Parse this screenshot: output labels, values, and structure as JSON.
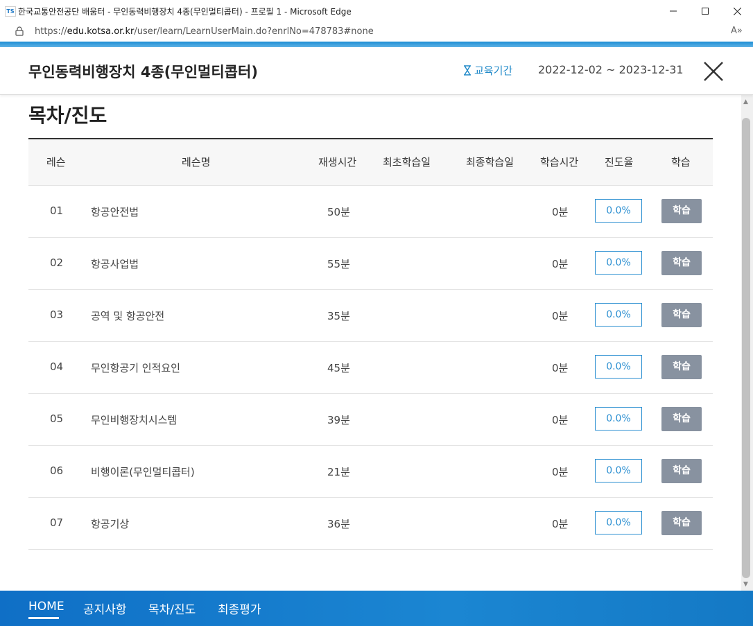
{
  "browser": {
    "logo_text": "TS",
    "window_title": "한국교통안전공단 배움터 - 무인동력비행장치 4종(무인멀티콥터) - 프로필 1 - Microsoft Edge",
    "url_prefix": "https://",
    "url_domain": "edu.kotsa.or.kr",
    "url_path": "/user/learn/LearnUserMain.do?enrlNo=478783#none",
    "read_aloud": "A»"
  },
  "header": {
    "course_title": "무인동력비행장치 4종(무인멀티콥터)",
    "period_label": "교육기간",
    "period_value": "2022-12-02 ~ 2023-12-31"
  },
  "section_title": "목차/진도",
  "table": {
    "columns": [
      "레슨",
      "레슨명",
      "재생시간",
      "최초학습일",
      "최종학습일",
      "학습시간",
      "진도율",
      "학습"
    ],
    "rows": [
      {
        "no": "01",
        "name": "항공안전법",
        "duration": "50분",
        "first": "",
        "last": "",
        "study_time": "0분",
        "progress": "0.0%",
        "button": "학습"
      },
      {
        "no": "02",
        "name": "항공사업법",
        "duration": "55분",
        "first": "",
        "last": "",
        "study_time": "0분",
        "progress": "0.0%",
        "button": "학습"
      },
      {
        "no": "03",
        "name": "공역 및 항공안전",
        "duration": "35분",
        "first": "",
        "last": "",
        "study_time": "0분",
        "progress": "0.0%",
        "button": "학습"
      },
      {
        "no": "04",
        "name": "무인항공기 인적요인",
        "duration": "45분",
        "first": "",
        "last": "",
        "study_time": "0분",
        "progress": "0.0%",
        "button": "학습"
      },
      {
        "no": "05",
        "name": "무인비행장치시스템",
        "duration": "39분",
        "first": "",
        "last": "",
        "study_time": "0분",
        "progress": "0.0%",
        "button": "학습"
      },
      {
        "no": "06",
        "name": "비행이론(무인멀티콥터)",
        "duration": "21분",
        "first": "",
        "last": "",
        "study_time": "0분",
        "progress": "0.0%",
        "button": "학습"
      },
      {
        "no": "07",
        "name": "항공기상",
        "duration": "36분",
        "first": "",
        "last": "",
        "study_time": "0분",
        "progress": "0.0%",
        "button": "학습"
      }
    ]
  },
  "bottom_nav": {
    "items": [
      "HOME",
      "공지사항",
      "목차/진도",
      "최종평가"
    ],
    "active": "HOME"
  },
  "colors": {
    "accent": "#1e88c8",
    "nav_bg": "#1479c5",
    "learn_button": "#8892a0"
  }
}
